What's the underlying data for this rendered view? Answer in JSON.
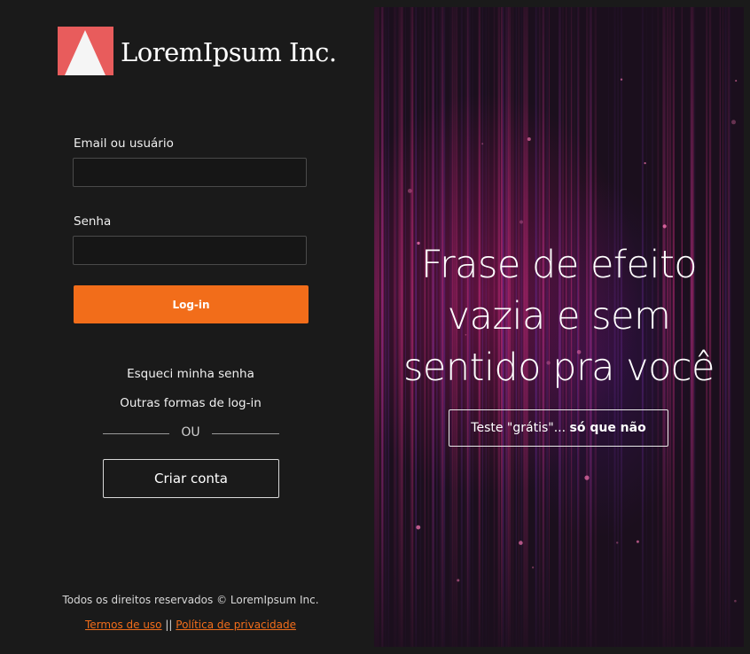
{
  "brand": {
    "name": "LoremIpsum Inc.",
    "logo_icon": "triangle-logo-icon",
    "logo_color": "#e85c5c"
  },
  "login_form": {
    "email_label": "Email ou usuário",
    "email_value": "",
    "password_label": "Senha",
    "password_value": "",
    "submit_label": "Log-in",
    "submit_color": "#f26d1a"
  },
  "links": {
    "forgot_password": "Esqueci minha senha",
    "other_login": "Outras formas de log-in",
    "divider_text": "OU",
    "create_account": "Criar conta"
  },
  "footer": {
    "copyright": "Todos os direitos reservados © LoremIpsum Inc.",
    "terms": "Termos de uso",
    "separator": "||",
    "privacy": "Política de privacidade",
    "link_color": "#f26d1a"
  },
  "hero": {
    "headline_lines": [
      "Frase de efeito",
      "vazia e sem",
      "sentido pra você"
    ],
    "cta_prefix": "Teste \"grátis\"...",
    "cta_bold": "só que não"
  }
}
